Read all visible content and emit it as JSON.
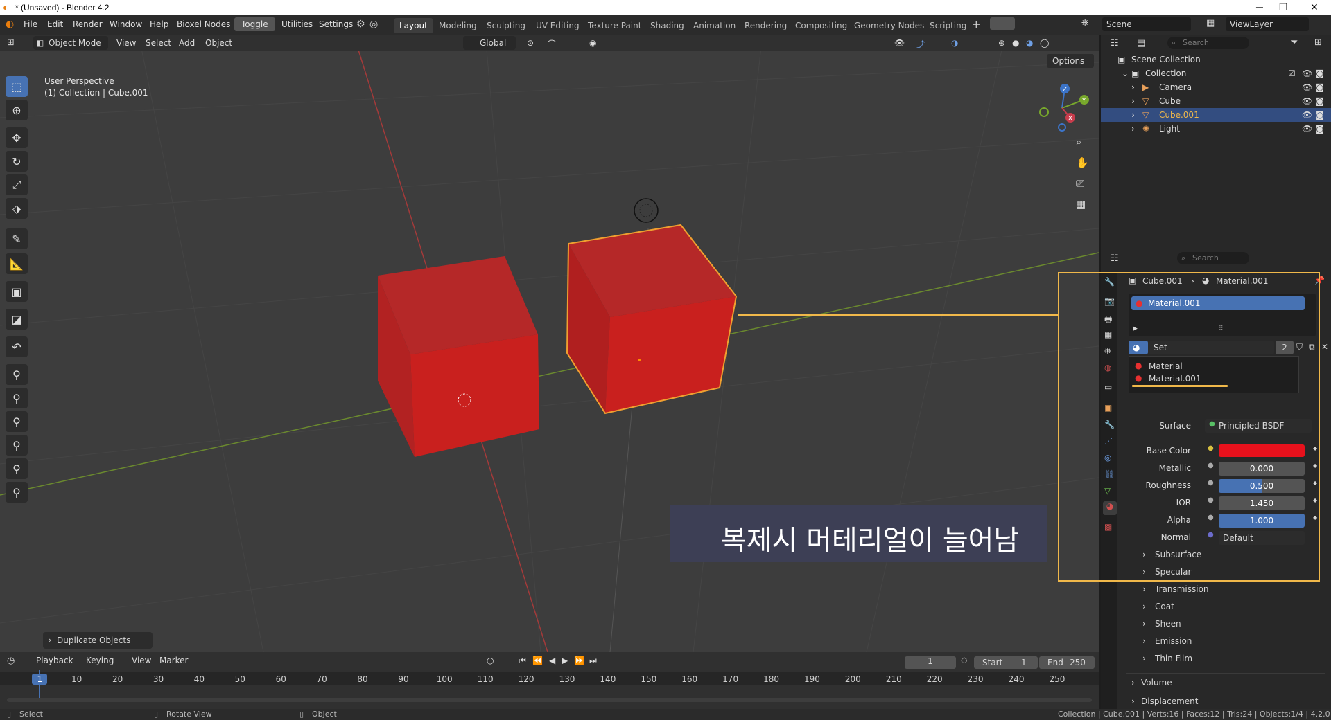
{
  "titlebar": {
    "title": "* (Unsaved) - Blender 4.2",
    "minimize": "─",
    "maximize": "❐",
    "close": "✕"
  },
  "menu": {
    "file": "File",
    "edit": "Edit",
    "render": "Render",
    "window": "Window",
    "help": "Help",
    "bioxel": "Bioxel Nodes",
    "toggle": "Toggle",
    "utilities": "Utilities",
    "settings": "Settings"
  },
  "workspaces": [
    "Layout",
    "Modeling",
    "Sculpting",
    "UV Editing",
    "Texture Paint",
    "Shading",
    "Animation",
    "Rendering",
    "Compositing",
    "Geometry Nodes",
    "Scripting"
  ],
  "scene": {
    "scene_name": "Scene",
    "view_layer": "ViewLayer"
  },
  "viewport_header": {
    "mode": "Object Mode",
    "view": "View",
    "select": "Select",
    "add": "Add",
    "object": "Object",
    "transform": "Global",
    "options": "Options"
  },
  "viewport_info": {
    "line1": "User Perspective",
    "line2": "(1) Collection | Cube.001"
  },
  "overlay_text": "복제시 머테리얼이 늘어남",
  "operator_panel": "Duplicate Objects",
  "outliner": {
    "search_placeholder": "Search",
    "scene_collection": "Scene Collection",
    "collection": "Collection",
    "items": [
      "Camera",
      "Cube",
      "Cube.001",
      "Light"
    ]
  },
  "properties": {
    "search_placeholder": "Search",
    "breadcrumb_object": "Cube.001",
    "breadcrumb_material": "Material.001",
    "slot": "Material.001",
    "set_label": "Set",
    "users": "2",
    "dropdown": [
      "Material",
      "Material.001"
    ],
    "surface_label": "Surface",
    "surface_value": "Principled BSDF",
    "fields": [
      {
        "label": "Base Color",
        "value": ""
      },
      {
        "label": "Metallic",
        "value": "0.000"
      },
      {
        "label": "Roughness",
        "value": "0.500"
      },
      {
        "label": "IOR",
        "value": "1.450"
      },
      {
        "label": "Alpha",
        "value": "1.000"
      },
      {
        "label": "Normal",
        "value": "Default"
      }
    ],
    "subpanels": [
      "Subsurface",
      "Specular",
      "Transmission",
      "Coat",
      "Sheen",
      "Emission",
      "Thin Film"
    ],
    "volume": "Volume",
    "displacement": "Displacement"
  },
  "timeline": {
    "playback": "Playback",
    "keying": "Keying",
    "view": "View",
    "marker": "Marker",
    "current_frame": "1",
    "start_label": "Start",
    "start": "1",
    "end_label": "End",
    "end": "250",
    "ticks": [
      "1",
      "10",
      "20",
      "30",
      "40",
      "50",
      "60",
      "70",
      "80",
      "90",
      "100",
      "110",
      "120",
      "130",
      "140",
      "150",
      "160",
      "170",
      "180",
      "190",
      "200",
      "210",
      "220",
      "230",
      "240",
      "250"
    ]
  },
  "statusbar": {
    "select": "Select",
    "rotate": "Rotate View",
    "object": "Object",
    "stats": "Collection | Cube.001 | Verts:16 | Faces:12 | Tris:24 | Objects:1/4 | 4.2.0"
  },
  "colors": {
    "accent": "#4772b3",
    "highlight": "#f0b84a",
    "cube": "#c9201e",
    "base_color": "#e8111c"
  }
}
